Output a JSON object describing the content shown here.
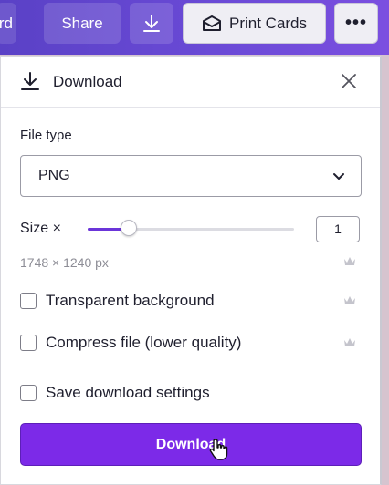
{
  "toolbar": {
    "partial_label": "rd",
    "share_label": "Share",
    "print_label": "Print Cards",
    "more_label": "•••"
  },
  "panel": {
    "title": "Download",
    "file_type_label": "File type",
    "file_type_value": "PNG",
    "size_label": "Size ×",
    "size_value": "1",
    "size_slider_fraction": 0.2,
    "dimensions": "1748 × 1240 px",
    "options": [
      {
        "label": "Transparent background",
        "checked": false,
        "premium": true
      },
      {
        "label": "Compress file (lower quality)",
        "checked": false,
        "premium": true
      },
      {
        "label": "Save download settings",
        "checked": false,
        "premium": false
      }
    ],
    "download_button": "Download"
  },
  "colors": {
    "accent": "#7c2ae8",
    "toolbar": "#6a4ad6",
    "slider_fill": "#6b35d9"
  },
  "icons": [
    "download-icon",
    "card-print-icon",
    "more-icon",
    "close-icon",
    "chevron-down-icon",
    "crown-icon",
    "hand-cursor-icon"
  ]
}
